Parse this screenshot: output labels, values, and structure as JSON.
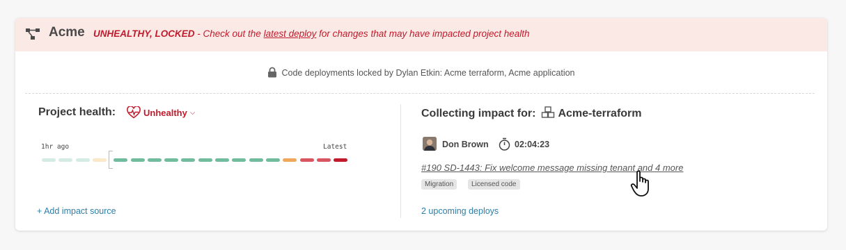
{
  "banner": {
    "project_name": "Acme",
    "status_strong": "UNHEALTHY, LOCKED",
    "status_prefix": " - Check out the ",
    "status_link": "latest deploy",
    "status_suffix": " for changes that may have impacted project health",
    "background_color": "#fbe9e6",
    "alert_color": "#c21a2b"
  },
  "lock_notice": {
    "text": "Code deployments locked by Dylan Etkin: Acme terraform, Acme application",
    "icon": "lock-icon"
  },
  "health": {
    "title": "Project health:",
    "status_label": "Unhealthy",
    "status_icon": "heart-pulse-icon",
    "timeline": {
      "start_label": "1hr ago",
      "end_label": "Latest",
      "segments": [
        {
          "state": "faded-healthy",
          "color": "#d4ece4"
        },
        {
          "state": "faded-healthy",
          "color": "#d4ece4"
        },
        {
          "state": "faded-healthy",
          "color": "#d4ece4"
        },
        {
          "state": "faded-warning",
          "color": "#fbe8c8"
        },
        {
          "state": "healthy",
          "color": "#72bc9e"
        },
        {
          "state": "healthy",
          "color": "#72bc9e"
        },
        {
          "state": "healthy",
          "color": "#72bc9e"
        },
        {
          "state": "healthy",
          "color": "#72bc9e"
        },
        {
          "state": "healthy",
          "color": "#72bc9e"
        },
        {
          "state": "healthy",
          "color": "#72bc9e"
        },
        {
          "state": "healthy",
          "color": "#72bc9e"
        },
        {
          "state": "healthy",
          "color": "#72bc9e"
        },
        {
          "state": "healthy",
          "color": "#72bc9e"
        },
        {
          "state": "healthy",
          "color": "#72bc9e"
        },
        {
          "state": "warning",
          "color": "#f0a85c"
        },
        {
          "state": "unhealthy",
          "color": "#d9555f"
        },
        {
          "state": "unhealthy",
          "color": "#d9555f"
        },
        {
          "state": "critical",
          "color": "#c21a2b"
        }
      ]
    },
    "add_source_label": "+ Add impact source"
  },
  "impact": {
    "title": "Collecting impact for:",
    "project_icon": "boxes-icon",
    "project_name": "Acme-terraform",
    "author": "Don Brown",
    "duration": "02:04:23",
    "deploy_link": "#190 SD-1443:  Fix welcome message missing tenant and 4 more",
    "tags": [
      "Migration",
      "Licensed code"
    ],
    "upcoming_label": "2 upcoming deploys",
    "link_color": "#2e7ea6"
  }
}
